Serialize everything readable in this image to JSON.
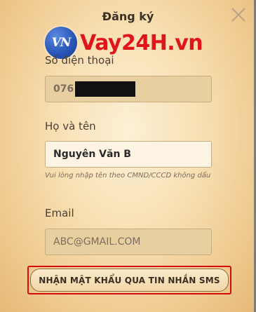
{
  "dialog": {
    "title": "Đăng ký",
    "close_icon": "close-icon"
  },
  "brand": {
    "logo_text": "VN",
    "name": "Vay24H.vn",
    "logo_color": "#2a56b8",
    "name_color": "#e0151a"
  },
  "form": {
    "phone": {
      "label": "Số điện thoại",
      "value": "076"
    },
    "fullname": {
      "label": "Họ và tên",
      "value": "Nguyên Văn B",
      "hint": "Vui lòng nhập tên theo CMND/CCCD không dấu"
    },
    "email": {
      "label": "Email",
      "value": "ABC@GMAIL.COM"
    }
  },
  "actions": {
    "sms_button_label": "NHẬN MẬT KHẨU QUA TIN NHẮN SMS",
    "highlight_color": "#d40c12"
  }
}
